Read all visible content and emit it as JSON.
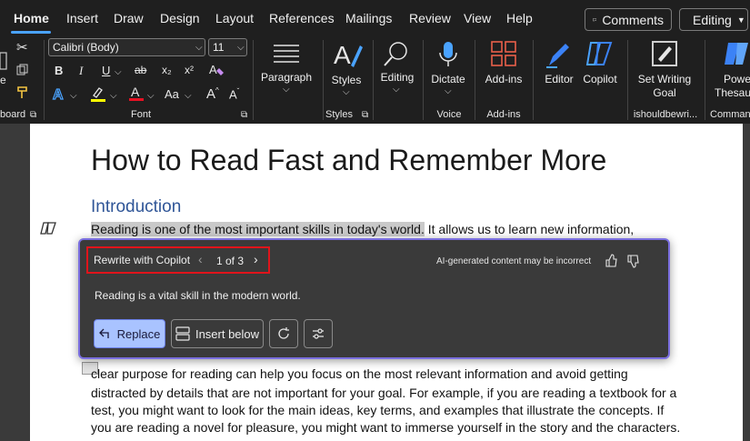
{
  "tabs": [
    "Home",
    "Insert",
    "Draw",
    "Design",
    "Layout",
    "References",
    "Mailings",
    "Review",
    "View",
    "Help"
  ],
  "top_buttons": {
    "comments": "Comments",
    "editing": "Editing"
  },
  "ribbon": {
    "font_name": "Calibri (Body)",
    "font_size": "11",
    "clipboard_label": "board",
    "font_group_label": "Font",
    "paragraph_label": "Paragraph",
    "styles_label": "Styles",
    "styles_group_label": "Styles",
    "editing_label": "Editing",
    "dictate_label": "Dictate",
    "voice_group_label": "Voice",
    "addins_label": "Add-ins",
    "addins_group_label": "Add-ins",
    "editor_label": "Editor",
    "copilot_label": "Copilot",
    "set_goal_label_1": "Set Writing",
    "set_goal_label_2": "Goal",
    "goal_group_label": "ishouldbewri...",
    "power_label_1": "Powe",
    "power_label_2": "Thesau",
    "command_group_label": "Comman",
    "font_btns": {
      "bold": "B",
      "italic": "I",
      "underline": "U",
      "strike": "ab",
      "sub": "x₂",
      "sup": "x²",
      "case": "Aa"
    }
  },
  "document": {
    "title": "How to Read Fast and Remember More",
    "heading": "Introduction",
    "line1_highlighted": "Reading is one of the most important skills in today's world.",
    "line1_rest": " It allows us to learn new information,",
    "line_a": "clear purpose for reading can help you focus on the most relevant information and avoid getting",
    "line_b": "distracted by details that are not important for your goal. For example, if you are reading a textbook for a",
    "line_c": "test, you might want to look for the main ideas, key terms, and examples that illustrate the concepts. If",
    "line_d": "you are reading a novel for pleasure, you might want to immerse yourself in the story and the characters."
  },
  "copilot": {
    "header": "Rewrite with Copilot",
    "pager": "1 of 3",
    "disclaimer": "AI-generated content may be incorrect",
    "suggestion": "Reading is a vital skill in the modern world.",
    "replace_label": "Replace",
    "insert_label": "Insert below"
  },
  "colors": {
    "accent": "#4aa3ff",
    "highlight_box": "#e0141b",
    "panel_border": "#7b6fe0",
    "heading": "#2f5597"
  }
}
